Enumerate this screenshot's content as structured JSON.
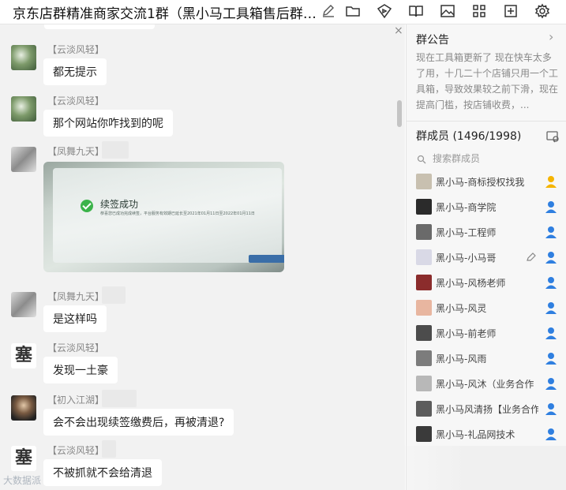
{
  "header": {
    "title": "京东店群精准商家交流1群（黑小马工具箱售后群…",
    "icons": [
      "edit-icon",
      "folder-icon",
      "play-icon",
      "book-icon",
      "image-icon",
      "apps-icon",
      "add-icon",
      "settings-icon"
    ]
  },
  "chat": {
    "close_glyph": "×",
    "messages": [
      {
        "sender": "【云淡风轻】",
        "text": "都无提示"
      },
      {
        "sender": "【云淡风轻】",
        "text": "那个网站你咋找到的呢"
      },
      {
        "sender": "【凤舞九天】",
        "image": {
          "title": "续签成功",
          "subtitle": "恭喜您已成功完成续签，平台服务有效期已延长至2021年01月11日至2022年01月11日"
        }
      },
      {
        "sender": "【凤舞九天】",
        "text": "是这样吗"
      },
      {
        "sender": "【云淡风轻】",
        "text": "发现一土豪"
      },
      {
        "sender": "【初入江湖】",
        "text": "会不会出现续签缴费后，再被清退?"
      },
      {
        "sender": "【云淡风轻】",
        "text": "不被抓就不会给清退"
      }
    ],
    "watermark": "大数据派"
  },
  "panel": {
    "announcement_title": "群公告",
    "announcement_text": "现在工具箱更新了 现在快车太多了用，十几二十个店铺只用一个工具箱，导致效果较之前下滑，现在提高门槛，按店铺收费，...",
    "members_title": "群成员 (1496/1998)",
    "search_placeholder": "搜索群成员",
    "members": [
      {
        "name": "黑小马-商标授权找我",
        "role": "owner"
      },
      {
        "name": "黑小马-商学院",
        "role": "admin"
      },
      {
        "name": "黑小马-工程师",
        "role": "admin"
      },
      {
        "name": "黑小马-小马哥",
        "role": "admin"
      },
      {
        "name": "黑小马-风杨老师",
        "role": "admin"
      },
      {
        "name": "黑小马-风灵",
        "role": "admin"
      },
      {
        "name": "黑小马-前老师",
        "role": "admin"
      },
      {
        "name": "黑小马-风雨",
        "role": "admin"
      },
      {
        "name": "黑小马-风沐（业务合作",
        "role": "admin"
      },
      {
        "name": "黑小马风清扬【业务合作",
        "role": "admin"
      },
      {
        "name": "黑小马-礼品网技术",
        "role": "admin"
      }
    ]
  },
  "colors": {
    "owner": "#f5b400",
    "admin": "#2f7fe0",
    "accent": "#3bb34a"
  }
}
